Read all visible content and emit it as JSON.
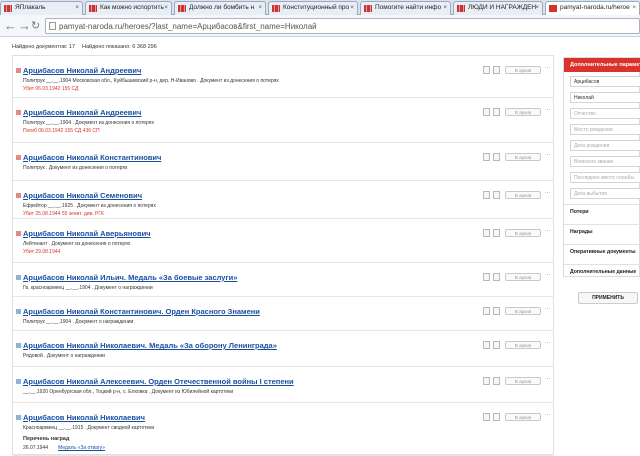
{
  "browser": {
    "tabs": [
      {
        "label": "ЯПлакаль",
        "active": false
      },
      {
        "label": "Как можно испортить",
        "active": false
      },
      {
        "label": "Должно ли бомбить н",
        "active": false
      },
      {
        "label": "Конституционный про",
        "active": false
      },
      {
        "label": "Помогите найти инфо",
        "active": false
      },
      {
        "label": "ЛЮДИ И НАГРАЖДЕН",
        "active": false
      },
      {
        "label": "pamyat-naroda.ru/heroe",
        "active": true
      }
    ],
    "url": "pamyat-naroda.ru/heroes/?last_name=Арцибасов&first_name=Николай",
    "back_glyph": "←",
    "forward_glyph": "→",
    "reload_glyph": "↻",
    "close_glyph": "×"
  },
  "counts": {
    "docs_found": "Найдено документов: 17",
    "shown": "Найдено показано: 6 368 296"
  },
  "results_ui": {
    "in_archive_label": "В архив",
    "more_glyph": "…"
  },
  "results": [
    {
      "title": "Арцибасов Николай Андреевич",
      "desc": "Политрук __.__.1904 Московская обл., Куйбышевский р-н, дер. Н-Иваново . Документ из донесения о потерях",
      "death": "Убит 06.03.1942 155 СД",
      "bullet_color": "#e08a8a"
    },
    {
      "title": "Арцибасов Николай Андреевич",
      "desc": "Политрук __.__.1904 . Документ из донесения о потерях",
      "death": "Погиб 06.03.1942 155 СД 436 СП",
      "bullet_color": "#e08a8a"
    },
    {
      "title": "Арцибасов Николай Константинович",
      "desc": "Политрук . Документ из донесения о потерях",
      "death": "",
      "bullet_color": "#e08a8a"
    },
    {
      "title": "Арцибасов Николай Семенович",
      "desc": "Ефрейтор __.__.1925 . Документ из донесения о потерях",
      "death": "Убит 25.08.1944 55 зенит. див. РГК",
      "bullet_color": "#e08a8a"
    },
    {
      "title": "Арцибасов Николай Аверьянович",
      "desc": "Лейтенант . Документ из донесения о потерях",
      "death": "Убит 29.08.1944",
      "bullet_color": "#e08a8a"
    },
    {
      "title": "Арцибасов Николай Ильич. Медаль «За боевые заслуги»",
      "desc": "Гв. красноармеец __.__.1904 . Документ о награждении",
      "death": "",
      "bullet_color": "#8ab4d9"
    },
    {
      "title": "Арцибасов Николай Константинович. Орден Красного Знамени",
      "desc": "Политрук __.__.1904 . Документ о награждении",
      "death": "",
      "bullet_color": "#8ab4d9"
    },
    {
      "title": "Арцибасов Николай Николаевич. Медаль «За оборону Ленинграда»",
      "desc": "Рядовой . Документ о награждении",
      "death": "",
      "bullet_color": "#8ab4d9"
    },
    {
      "title": "Арцибасов Николай Алексеевич. Орден Отечественной войны I степени",
      "desc": "__.__.1920 Оренбургская обл., Тоцкий р-н, с. Елховка . Документ из Юбилейной картотеки",
      "death": "",
      "bullet_color": "#8ab4d9"
    },
    {
      "title": "Арцибасов Николай Николаевич",
      "desc": "Красноармеец __.__.1915 . Документ сводной картотеки",
      "death": "",
      "bullet_color": "#8ab4d9"
    }
  ],
  "last_result_extra": {
    "awards_heading": "Перечень наград",
    "award_date": "26.07.1944",
    "award_link": "Медаль «За отвагу»"
  },
  "sidebar": {
    "header": "Дополнительные параметры",
    "fields": [
      {
        "text": "Арцибасов",
        "filled": true
      },
      {
        "text": "Николай",
        "filled": true
      },
      {
        "text": "Отчество",
        "filled": false
      },
      {
        "text": "Место рождения",
        "filled": false
      },
      {
        "text": "Дата рождения",
        "filled": false
      },
      {
        "text": "Воинское звание",
        "filled": false
      },
      {
        "text": "Последнее место службы",
        "filled": false
      },
      {
        "text": "Дата выбытия",
        "filled": false
      }
    ],
    "sections": [
      "Потери",
      "Награды",
      "Оперативные документы",
      "Дополнительные данные"
    ],
    "apply_button": "ПРИМЕНИТЬ"
  },
  "colors": {
    "accent_red": "#d9332b",
    "link_blue": "#1a4fa0"
  }
}
